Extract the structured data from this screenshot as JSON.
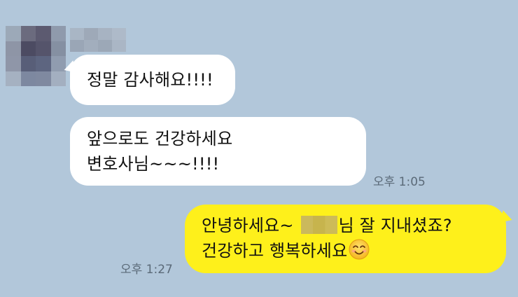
{
  "colors": {
    "background": "#b2c7da",
    "incoming_bubble": "#ffffff",
    "outgoing_bubble": "#fef01b",
    "timestamp": "#5b6a78"
  },
  "messages": [
    {
      "direction": "incoming",
      "lines": [
        "정말 감사해요!!!!"
      ]
    },
    {
      "direction": "incoming",
      "lines": [
        "앞으로도 건강하세요",
        "변호사님~~~!!!!"
      ],
      "time": "오후 1:05"
    },
    {
      "direction": "outgoing",
      "line1_before": "안녕하세요~",
      "line1_after": "님 잘 지내셨죠?",
      "line2": "건강하고 행복하세요",
      "emoji": "smiling-face-emoji",
      "time": "오후 1:27"
    }
  ]
}
